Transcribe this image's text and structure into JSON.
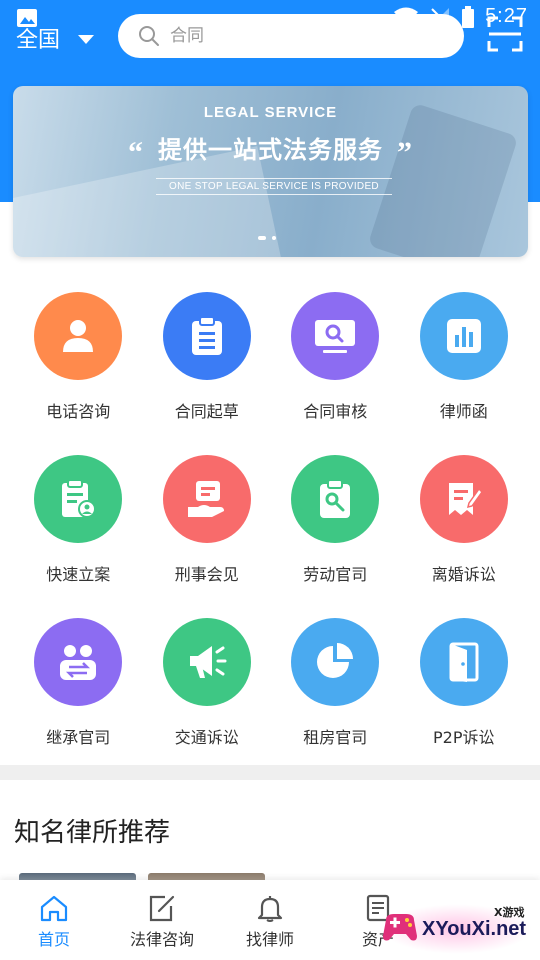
{
  "status_bar": {
    "time": "5:27"
  },
  "header": {
    "region": "全国",
    "search_placeholder": "合同"
  },
  "banner": {
    "title_en": "LEGAL SERVICE",
    "title_cn": "提供一站式法务服务",
    "subtitle_en": "ONE STOP LEGAL SERVICE IS PROVIDED",
    "open_quote": "“",
    "close_quote": "”"
  },
  "services": [
    {
      "label": "电话咨询",
      "icon": "person-icon",
      "color": "#ff8a4c"
    },
    {
      "label": "合同起草",
      "icon": "clipboard-icon",
      "color": "#3b7cf5"
    },
    {
      "label": "合同审核",
      "icon": "monitor-search-icon",
      "color": "#8c6cf2"
    },
    {
      "label": "律师函",
      "icon": "bar-chart-icon",
      "color": "#4aaaf0"
    },
    {
      "label": "快速立案",
      "icon": "case-file-icon",
      "color": "#3ec784"
    },
    {
      "label": "刑事会见",
      "icon": "hand-card-icon",
      "color": "#f86b6b"
    },
    {
      "label": "劳动官司",
      "icon": "clipboard-tool-icon",
      "color": "#3ec784"
    },
    {
      "label": "离婚诉讼",
      "icon": "document-pen-icon",
      "color": "#f86b6b"
    },
    {
      "label": "继承官司",
      "icon": "people-exchange-icon",
      "color": "#8c6cf2"
    },
    {
      "label": "交通诉讼",
      "icon": "megaphone-icon",
      "color": "#3ec784"
    },
    {
      "label": "租房官司",
      "icon": "pie-chart-icon",
      "color": "#4aaaf0"
    },
    {
      "label": "P2P诉讼",
      "icon": "door-icon",
      "color": "#4aaaf0"
    }
  ],
  "section": {
    "title": "知名律所推荐"
  },
  "bottom_nav": [
    {
      "label": "首页",
      "icon": "home-icon",
      "active": true
    },
    {
      "label": "法律咨询",
      "icon": "edit-icon",
      "active": false
    },
    {
      "label": "找律师",
      "icon": "bell-icon",
      "active": false
    },
    {
      "label": "资产",
      "icon": "document-icon",
      "active": false
    }
  ],
  "watermark": {
    "text": "XYouXi.net",
    "small_text": "X游戏"
  },
  "colors": {
    "primary": "#1a8cff",
    "divider": "#efefef"
  }
}
